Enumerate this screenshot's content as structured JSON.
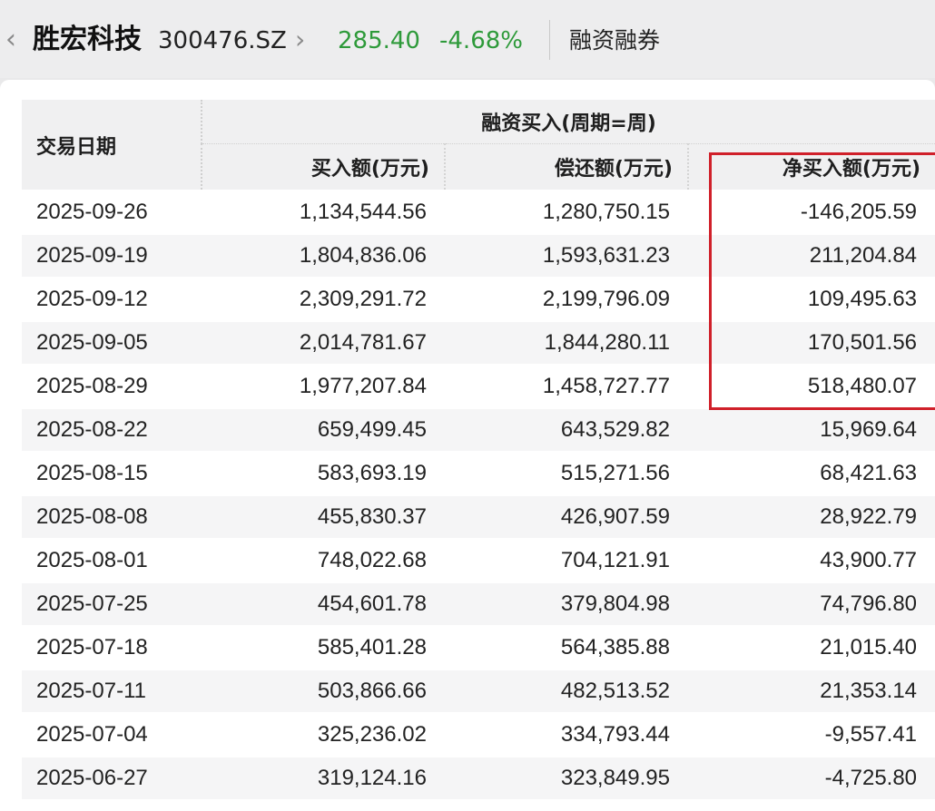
{
  "header": {
    "back_icon": "chevron-left-icon",
    "stock_name": "胜宏科技",
    "stock_code": "300476.SZ",
    "forward_icon": "chevron-right-icon",
    "price": "285.40",
    "change": "-4.68%",
    "tab_label": "融资融券",
    "price_color": "#2e9a3a"
  },
  "table": {
    "date_header": "交易日期",
    "group_header": "融资买入(周期=周)",
    "columns": [
      "买入额(万元)",
      "偿还额(万元)",
      "净买入额(万元)"
    ],
    "highlight_color": "#d0202a",
    "rows": [
      {
        "date": "2025-09-26",
        "buy": "1,134,544.56",
        "repay": "1,280,750.15",
        "net": "-146,205.59"
      },
      {
        "date": "2025-09-19",
        "buy": "1,804,836.06",
        "repay": "1,593,631.23",
        "net": "211,204.84"
      },
      {
        "date": "2025-09-12",
        "buy": "2,309,291.72",
        "repay": "2,199,796.09",
        "net": "109,495.63"
      },
      {
        "date": "2025-09-05",
        "buy": "2,014,781.67",
        "repay": "1,844,280.11",
        "net": "170,501.56"
      },
      {
        "date": "2025-08-29",
        "buy": "1,977,207.84",
        "repay": "1,458,727.77",
        "net": "518,480.07"
      },
      {
        "date": "2025-08-22",
        "buy": "659,499.45",
        "repay": "643,529.82",
        "net": "15,969.64"
      },
      {
        "date": "2025-08-15",
        "buy": "583,693.19",
        "repay": "515,271.56",
        "net": "68,421.63"
      },
      {
        "date": "2025-08-08",
        "buy": "455,830.37",
        "repay": "426,907.59",
        "net": "28,922.79"
      },
      {
        "date": "2025-08-01",
        "buy": "748,022.68",
        "repay": "704,121.91",
        "net": "43,900.77"
      },
      {
        "date": "2025-07-25",
        "buy": "454,601.78",
        "repay": "379,804.98",
        "net": "74,796.80"
      },
      {
        "date": "2025-07-18",
        "buy": "585,401.28",
        "repay": "564,385.88",
        "net": "21,015.40"
      },
      {
        "date": "2025-07-11",
        "buy": "503,866.66",
        "repay": "482,513.52",
        "net": "21,353.14"
      },
      {
        "date": "2025-07-04",
        "buy": "325,236.02",
        "repay": "334,793.44",
        "net": "-9,557.41"
      },
      {
        "date": "2025-06-27",
        "buy": "319,124.16",
        "repay": "323,849.95",
        "net": "-4,725.80"
      }
    ]
  }
}
